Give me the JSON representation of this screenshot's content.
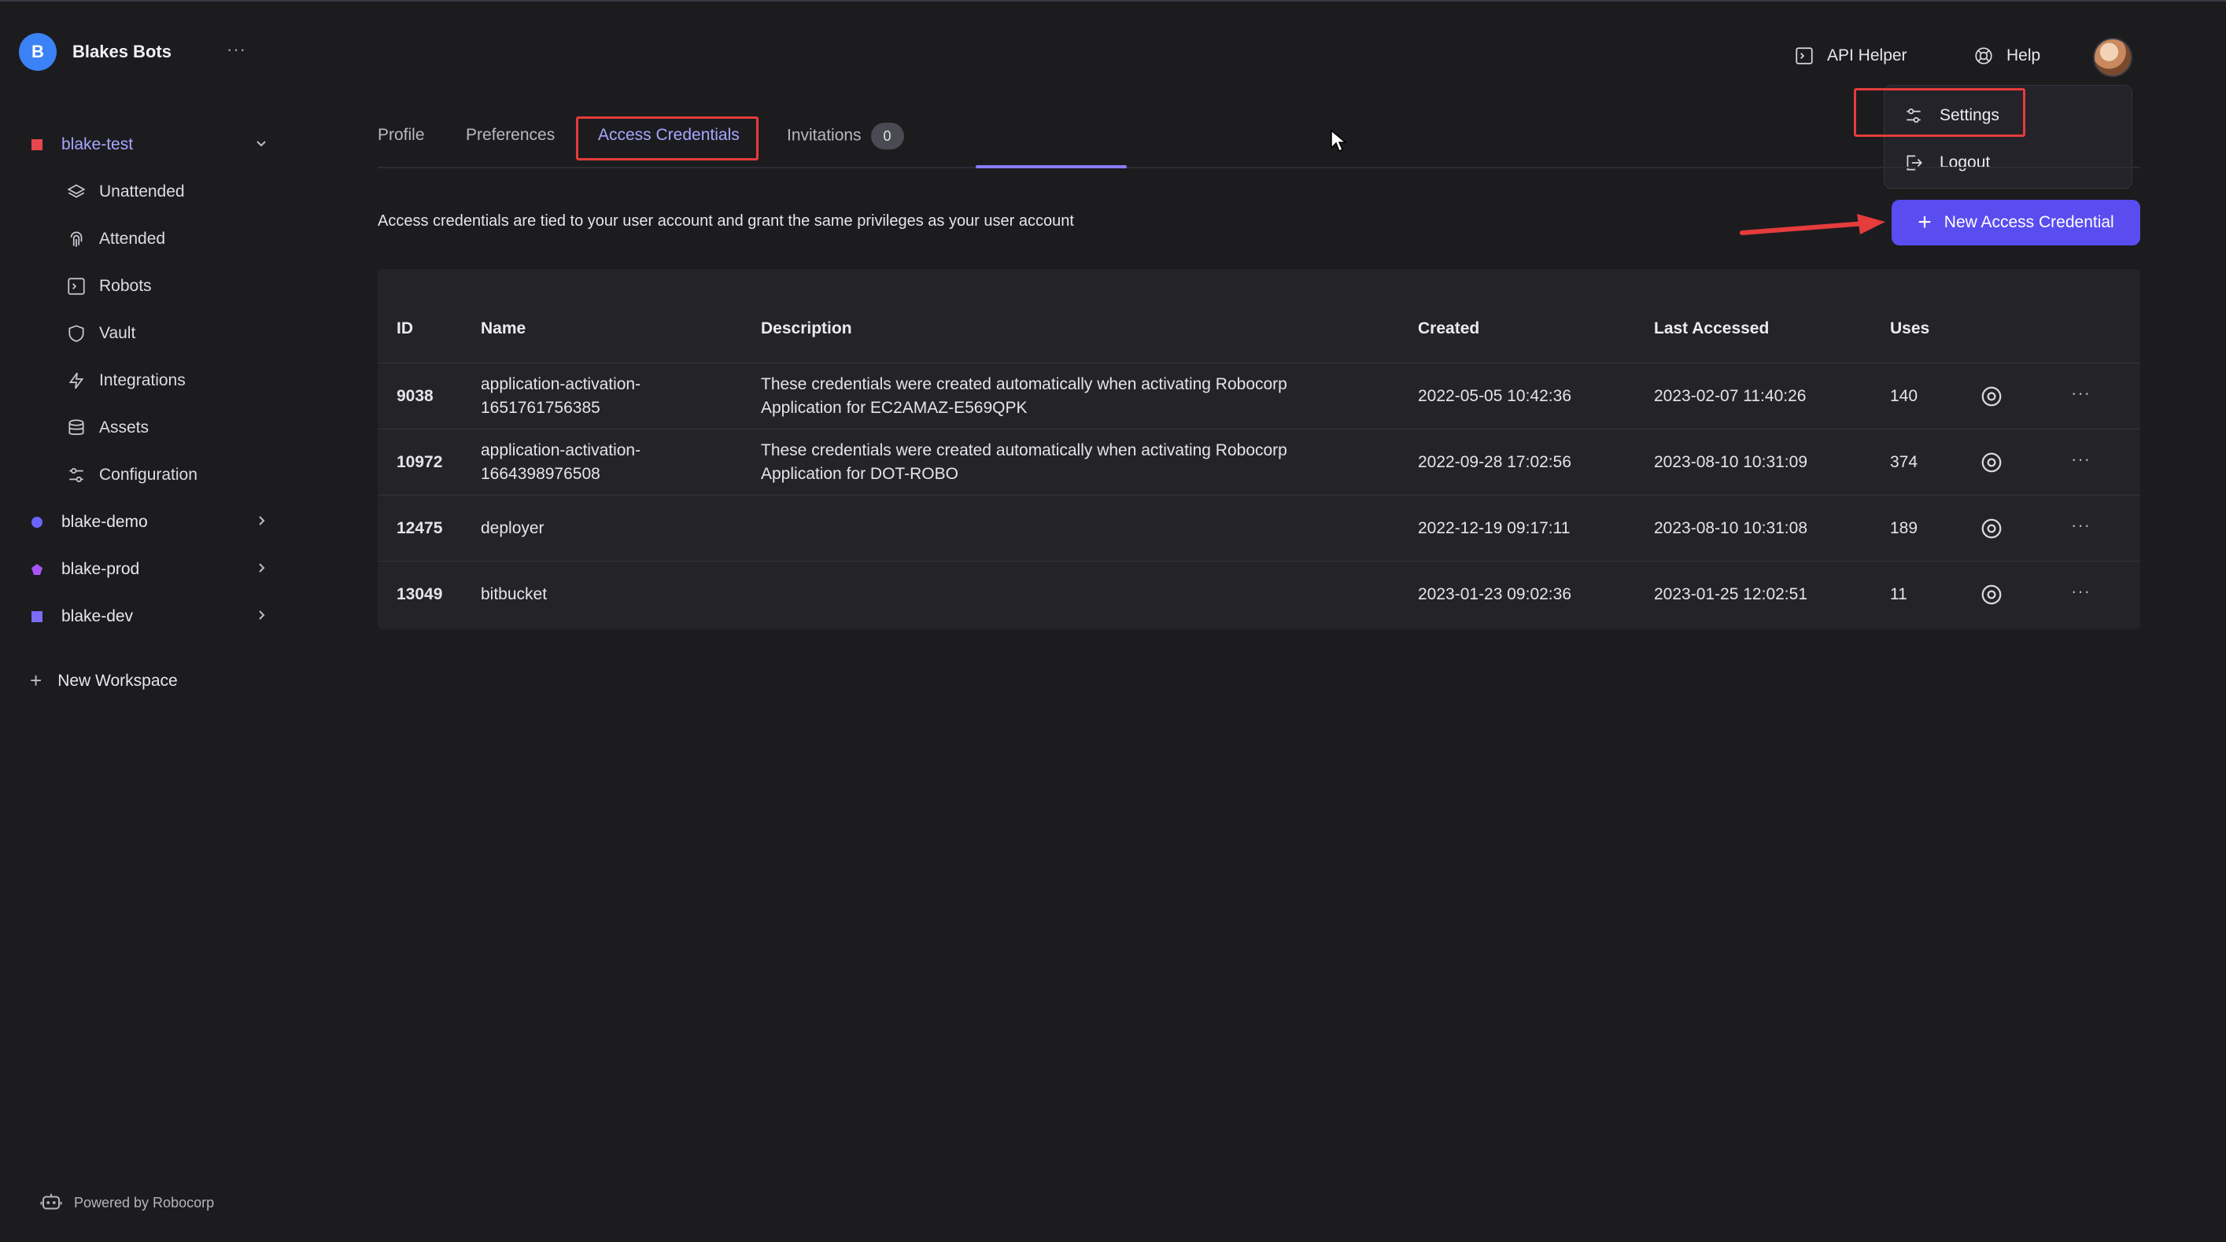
{
  "org": {
    "initial": "B",
    "name": "Blakes Bots",
    "more": "···"
  },
  "workspaces": [
    {
      "name": "blake-test",
      "color": "#e5484d",
      "shape": "square",
      "chevron": "⌄",
      "active": true
    },
    {
      "name": "blake-demo",
      "color": "#6c63ff",
      "shape": "circle",
      "chevron": "›"
    },
    {
      "name": "blake-prod",
      "color": "#a855f7",
      "shape": "pentagon",
      "chevron": "›"
    },
    {
      "name": "blake-dev",
      "color": "#7c6cf6",
      "shape": "square",
      "chevron": "›"
    }
  ],
  "nav": [
    {
      "label": "Unattended",
      "icon": "layers-icon"
    },
    {
      "label": "Attended",
      "icon": "fingerprint-icon"
    },
    {
      "label": "Robots",
      "icon": "terminal-icon"
    },
    {
      "label": "Vault",
      "icon": "shield-icon"
    },
    {
      "label": "Integrations",
      "icon": "lightning-icon"
    },
    {
      "label": "Assets",
      "icon": "database-icon"
    },
    {
      "label": "Configuration",
      "icon": "sliders-icon"
    }
  ],
  "new_workspace": {
    "plus": "+",
    "label": "New Workspace"
  },
  "footer": {
    "label": "Powered by Robocorp"
  },
  "header": {
    "api_helper": "API Helper",
    "help": "Help"
  },
  "dropdown": {
    "settings": "Settings",
    "logout": "Logout"
  },
  "tabs": [
    {
      "label": "Profile"
    },
    {
      "label": "Preferences"
    },
    {
      "label": "Access Credentials",
      "active": true
    },
    {
      "label": "Invitations",
      "badge": "0"
    }
  ],
  "info_text": "Access credentials are tied to your user account and grant the same privileges as your user account",
  "new_credential_button": {
    "plus": "+",
    "label": "New Access Credential"
  },
  "table": {
    "columns": [
      "ID",
      "Name",
      "Description",
      "Created",
      "Last Accessed",
      "Uses"
    ],
    "rows": [
      {
        "id": "9038",
        "name": [
          "application-activation-",
          "1651761756385"
        ],
        "description": [
          "These credentials were created automatically when activating Robocorp",
          "Application for EC2AMAZ-E569QPK"
        ],
        "created": "2022-05-05 10:42:36",
        "last_accessed": "2023-02-07 11:40:26",
        "uses": "140",
        "more": "···"
      },
      {
        "id": "10972",
        "name": [
          "application-activation-",
          "1664398976508"
        ],
        "description": [
          "These credentials were created automatically when activating Robocorp",
          "Application for DOT-ROBO"
        ],
        "created": "2022-09-28 17:02:56",
        "last_accessed": "2023-08-10 10:31:09",
        "uses": "374",
        "more": "···"
      },
      {
        "id": "12475",
        "name": [
          "deployer",
          ""
        ],
        "description": [
          "",
          ""
        ],
        "created": "2022-12-19 09:17:11",
        "last_accessed": "2023-08-10 10:31:08",
        "uses": "189",
        "more": "···"
      },
      {
        "id": "13049",
        "name": [
          "bitbucket",
          ""
        ],
        "description": [
          "",
          ""
        ],
        "created": "2023-01-23 09:02:36",
        "last_accessed": "2023-01-25 12:02:51",
        "uses": "11",
        "more": "···"
      }
    ]
  }
}
